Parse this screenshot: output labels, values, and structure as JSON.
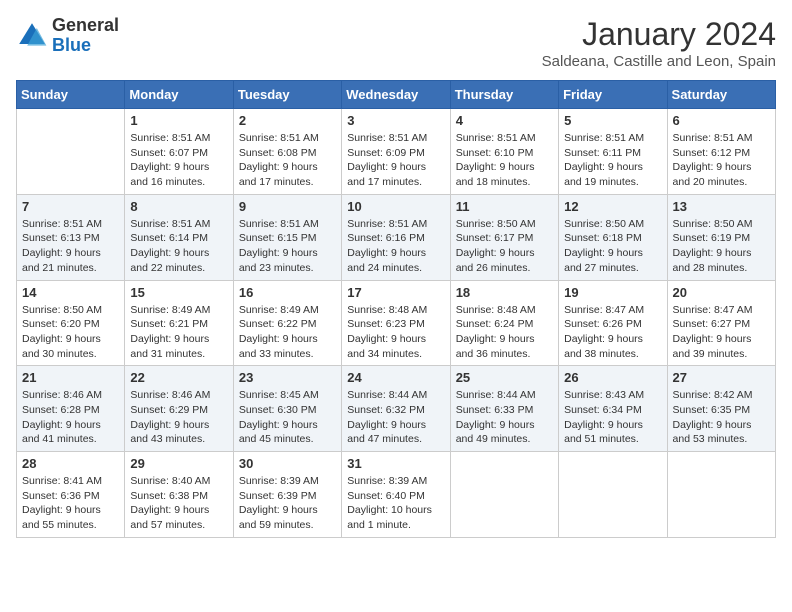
{
  "header": {
    "logo_general": "General",
    "logo_blue": "Blue",
    "month": "January 2024",
    "location": "Saldeana, Castille and Leon, Spain"
  },
  "days_of_week": [
    "Sunday",
    "Monday",
    "Tuesday",
    "Wednesday",
    "Thursday",
    "Friday",
    "Saturday"
  ],
  "weeks": [
    [
      {
        "day": "",
        "sunrise": "",
        "sunset": "",
        "daylight": ""
      },
      {
        "day": "1",
        "sunrise": "Sunrise: 8:51 AM",
        "sunset": "Sunset: 6:07 PM",
        "daylight": "Daylight: 9 hours and 16 minutes."
      },
      {
        "day": "2",
        "sunrise": "Sunrise: 8:51 AM",
        "sunset": "Sunset: 6:08 PM",
        "daylight": "Daylight: 9 hours and 17 minutes."
      },
      {
        "day": "3",
        "sunrise": "Sunrise: 8:51 AM",
        "sunset": "Sunset: 6:09 PM",
        "daylight": "Daylight: 9 hours and 17 minutes."
      },
      {
        "day": "4",
        "sunrise": "Sunrise: 8:51 AM",
        "sunset": "Sunset: 6:10 PM",
        "daylight": "Daylight: 9 hours and 18 minutes."
      },
      {
        "day": "5",
        "sunrise": "Sunrise: 8:51 AM",
        "sunset": "Sunset: 6:11 PM",
        "daylight": "Daylight: 9 hours and 19 minutes."
      },
      {
        "day": "6",
        "sunrise": "Sunrise: 8:51 AM",
        "sunset": "Sunset: 6:12 PM",
        "daylight": "Daylight: 9 hours and 20 minutes."
      }
    ],
    [
      {
        "day": "7",
        "sunrise": "Sunrise: 8:51 AM",
        "sunset": "Sunset: 6:13 PM",
        "daylight": "Daylight: 9 hours and 21 minutes."
      },
      {
        "day": "8",
        "sunrise": "Sunrise: 8:51 AM",
        "sunset": "Sunset: 6:14 PM",
        "daylight": "Daylight: 9 hours and 22 minutes."
      },
      {
        "day": "9",
        "sunrise": "Sunrise: 8:51 AM",
        "sunset": "Sunset: 6:15 PM",
        "daylight": "Daylight: 9 hours and 23 minutes."
      },
      {
        "day": "10",
        "sunrise": "Sunrise: 8:51 AM",
        "sunset": "Sunset: 6:16 PM",
        "daylight": "Daylight: 9 hours and 24 minutes."
      },
      {
        "day": "11",
        "sunrise": "Sunrise: 8:50 AM",
        "sunset": "Sunset: 6:17 PM",
        "daylight": "Daylight: 9 hours and 26 minutes."
      },
      {
        "day": "12",
        "sunrise": "Sunrise: 8:50 AM",
        "sunset": "Sunset: 6:18 PM",
        "daylight": "Daylight: 9 hours and 27 minutes."
      },
      {
        "day": "13",
        "sunrise": "Sunrise: 8:50 AM",
        "sunset": "Sunset: 6:19 PM",
        "daylight": "Daylight: 9 hours and 28 minutes."
      }
    ],
    [
      {
        "day": "14",
        "sunrise": "Sunrise: 8:50 AM",
        "sunset": "Sunset: 6:20 PM",
        "daylight": "Daylight: 9 hours and 30 minutes."
      },
      {
        "day": "15",
        "sunrise": "Sunrise: 8:49 AM",
        "sunset": "Sunset: 6:21 PM",
        "daylight": "Daylight: 9 hours and 31 minutes."
      },
      {
        "day": "16",
        "sunrise": "Sunrise: 8:49 AM",
        "sunset": "Sunset: 6:22 PM",
        "daylight": "Daylight: 9 hours and 33 minutes."
      },
      {
        "day": "17",
        "sunrise": "Sunrise: 8:48 AM",
        "sunset": "Sunset: 6:23 PM",
        "daylight": "Daylight: 9 hours and 34 minutes."
      },
      {
        "day": "18",
        "sunrise": "Sunrise: 8:48 AM",
        "sunset": "Sunset: 6:24 PM",
        "daylight": "Daylight: 9 hours and 36 minutes."
      },
      {
        "day": "19",
        "sunrise": "Sunrise: 8:47 AM",
        "sunset": "Sunset: 6:26 PM",
        "daylight": "Daylight: 9 hours and 38 minutes."
      },
      {
        "day": "20",
        "sunrise": "Sunrise: 8:47 AM",
        "sunset": "Sunset: 6:27 PM",
        "daylight": "Daylight: 9 hours and 39 minutes."
      }
    ],
    [
      {
        "day": "21",
        "sunrise": "Sunrise: 8:46 AM",
        "sunset": "Sunset: 6:28 PM",
        "daylight": "Daylight: 9 hours and 41 minutes."
      },
      {
        "day": "22",
        "sunrise": "Sunrise: 8:46 AM",
        "sunset": "Sunset: 6:29 PM",
        "daylight": "Daylight: 9 hours and 43 minutes."
      },
      {
        "day": "23",
        "sunrise": "Sunrise: 8:45 AM",
        "sunset": "Sunset: 6:30 PM",
        "daylight": "Daylight: 9 hours and 45 minutes."
      },
      {
        "day": "24",
        "sunrise": "Sunrise: 8:44 AM",
        "sunset": "Sunset: 6:32 PM",
        "daylight": "Daylight: 9 hours and 47 minutes."
      },
      {
        "day": "25",
        "sunrise": "Sunrise: 8:44 AM",
        "sunset": "Sunset: 6:33 PM",
        "daylight": "Daylight: 9 hours and 49 minutes."
      },
      {
        "day": "26",
        "sunrise": "Sunrise: 8:43 AM",
        "sunset": "Sunset: 6:34 PM",
        "daylight": "Daylight: 9 hours and 51 minutes."
      },
      {
        "day": "27",
        "sunrise": "Sunrise: 8:42 AM",
        "sunset": "Sunset: 6:35 PM",
        "daylight": "Daylight: 9 hours and 53 minutes."
      }
    ],
    [
      {
        "day": "28",
        "sunrise": "Sunrise: 8:41 AM",
        "sunset": "Sunset: 6:36 PM",
        "daylight": "Daylight: 9 hours and 55 minutes."
      },
      {
        "day": "29",
        "sunrise": "Sunrise: 8:40 AM",
        "sunset": "Sunset: 6:38 PM",
        "daylight": "Daylight: 9 hours and 57 minutes."
      },
      {
        "day": "30",
        "sunrise": "Sunrise: 8:39 AM",
        "sunset": "Sunset: 6:39 PM",
        "daylight": "Daylight: 9 hours and 59 minutes."
      },
      {
        "day": "31",
        "sunrise": "Sunrise: 8:39 AM",
        "sunset": "Sunset: 6:40 PM",
        "daylight": "Daylight: 10 hours and 1 minute."
      },
      {
        "day": "",
        "sunrise": "",
        "sunset": "",
        "daylight": ""
      },
      {
        "day": "",
        "sunrise": "",
        "sunset": "",
        "daylight": ""
      },
      {
        "day": "",
        "sunrise": "",
        "sunset": "",
        "daylight": ""
      }
    ]
  ]
}
